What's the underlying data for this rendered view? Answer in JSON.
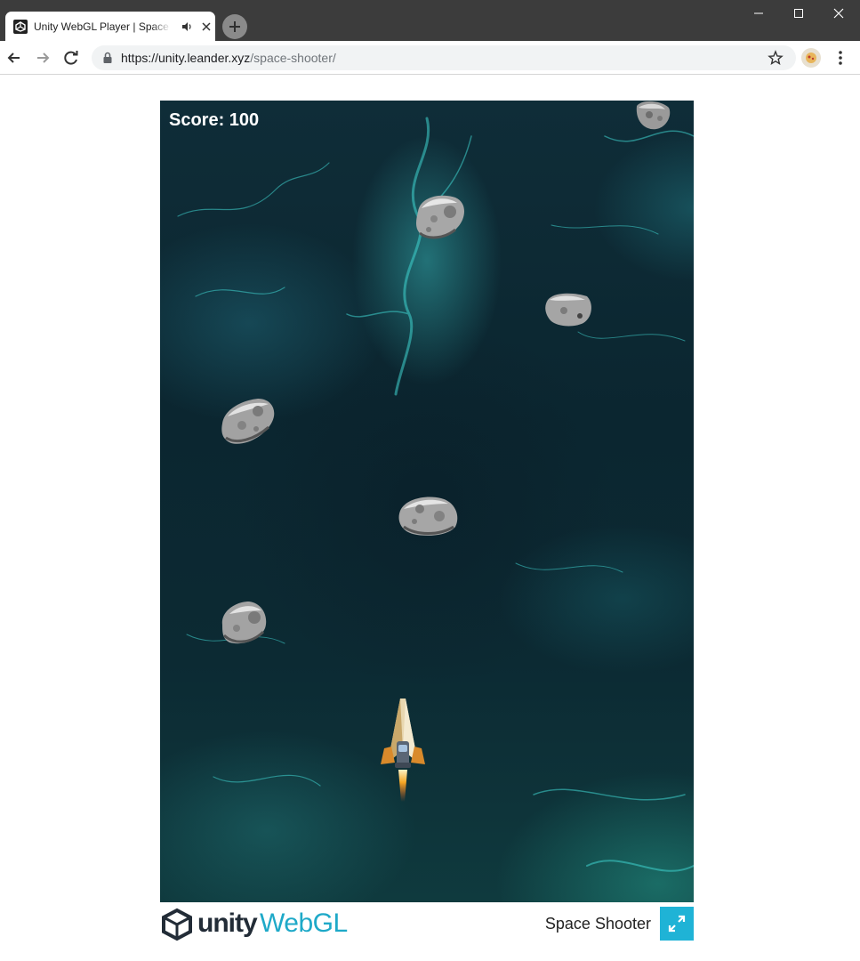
{
  "browser": {
    "tab_title": "Unity WebGL Player | Space Shooter",
    "url_host": "https://unity.leander.xyz",
    "url_path": "/space-shooter/"
  },
  "game": {
    "score_text": "Score: 100"
  },
  "footer": {
    "logo_word": "unity",
    "logo_word2": "WebGL",
    "game_title": "Space Shooter"
  },
  "colors": {
    "accent": "#1fb3d6",
    "chrome_dark": "#3c3c3c"
  }
}
